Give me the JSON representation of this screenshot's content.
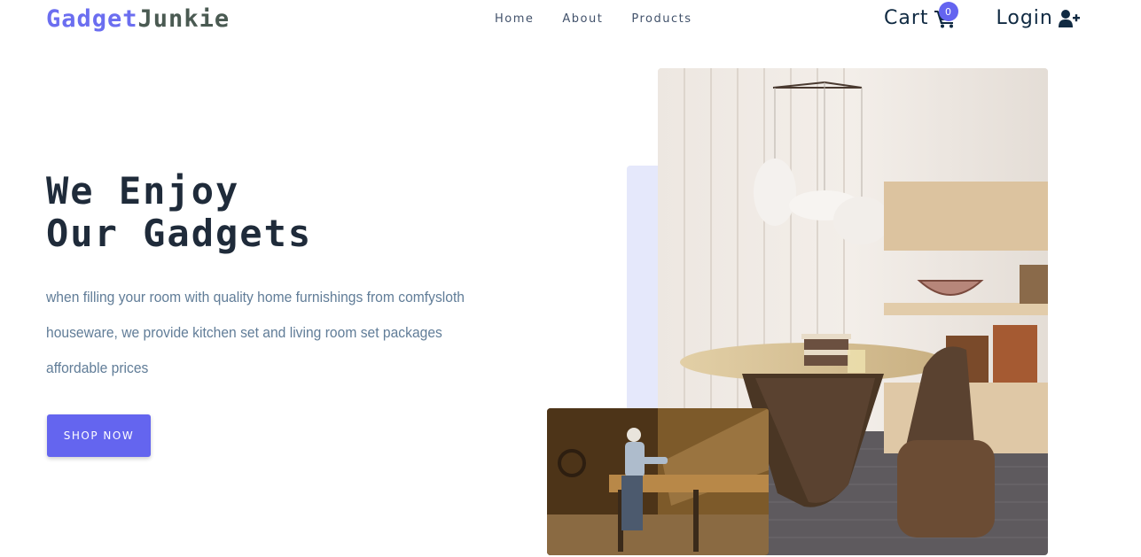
{
  "nav": {
    "logo_part1": "Gadget",
    "logo_part2": "Junkie",
    "links": [
      "Home",
      "About",
      "Products"
    ],
    "cart_label": "Cart",
    "cart_count": "0",
    "login_label": "Login"
  },
  "hero": {
    "title_line1": "We Enjoy",
    "title_line2": "Our Gadgets",
    "description": "when filling your room with quality home furnishings from comfysloth houseware, we provide kitchen set and living room set packages affordable prices",
    "cta_label": "SHOP NOW"
  },
  "colors": {
    "accent": "#6465ef",
    "title": "#1f2b3a",
    "text": "#617d98",
    "logo_secondary": "#4a5a52"
  },
  "icons": {
    "cart": "cart-icon",
    "login": "user-plus-icon"
  }
}
